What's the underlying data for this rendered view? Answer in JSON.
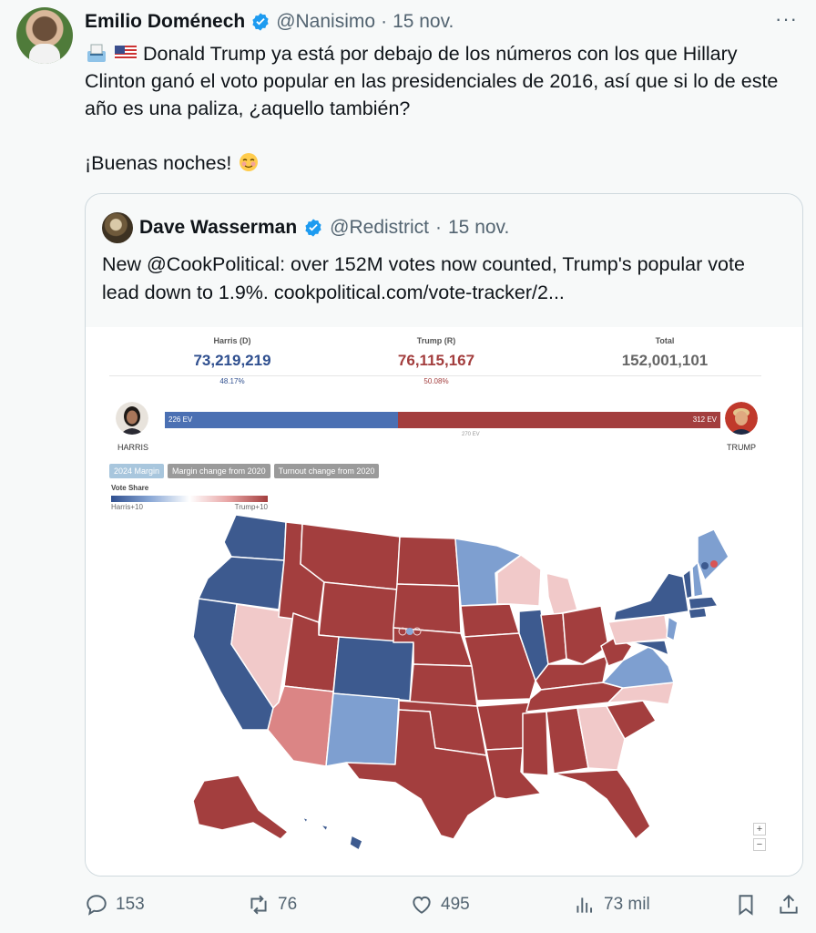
{
  "tweet": {
    "author_name": "Emilio Doménech",
    "author_handle": "@Nanisimo",
    "separator": "·",
    "date": "15 nov.",
    "more_label": "···",
    "text_line1": "Donald Trump ya está por debajo de los números con los que Hillary Clinton ganó el voto popular en las presidenciales de 2016, así que si lo de este año es una paliza, ¿aquello también?",
    "text_line2": "¡Buenas noches!",
    "emoji_icons": [
      "ballot-box-icon",
      "us-flag-icon",
      "smiling-blush-icon"
    ]
  },
  "quote": {
    "author_name": "Dave Wasserman",
    "author_handle": "@Redistrict",
    "separator": "·",
    "date": "15 nov.",
    "text": "New @CookPolitical: over 152M votes now counted, Trump's popular vote lead down to 1.9%. cookpolitical.com/vote-tracker/2..."
  },
  "tracker": {
    "harris": {
      "label": "Harris (D)",
      "votes": "73,219,219",
      "pct": "48.17%",
      "ev": "226 EV",
      "name": "HARRIS"
    },
    "trump": {
      "label": "Trump (R)",
      "votes": "76,115,167",
      "pct": "50.08%",
      "ev": "312 EV",
      "name": "TRUMP"
    },
    "total": {
      "label": "Total",
      "votes": "152,001,101"
    },
    "ev_mid": "270 EV",
    "ev_harris_fraction": 0.42,
    "buttons": [
      "2024 Margin",
      "Margin change from 2020",
      "Turnout change from 2020"
    ],
    "legend_title": "Vote Share",
    "legend_left": "Harris+10",
    "legend_right": "Trump+10",
    "zoom_in": "+",
    "zoom_out": "−",
    "colors": {
      "dem_strong": "#3d5a8f",
      "dem_lean": "#7e9fd0",
      "rep_strong": "#a33e3e",
      "rep_mid": "#db8585",
      "rep_lean": "#f1c9c9",
      "harris_text": "#2f4f8f",
      "trump_text": "#a33e3e",
      "total_text": "#666666"
    }
  },
  "actions": {
    "replies": "153",
    "retweets": "76",
    "likes": "495",
    "views": "73 mil"
  },
  "brand": {
    "verified": "#1d9bf0"
  }
}
